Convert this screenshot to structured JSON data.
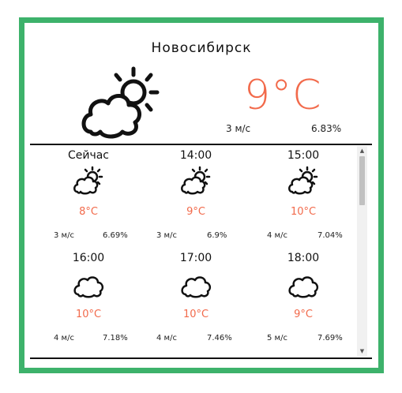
{
  "city": "Новосибирск",
  "current": {
    "icon": "partly-cloudy-icon",
    "temp": "9°C",
    "wind": "3 м/с",
    "humidity": "6.83%"
  },
  "forecast": [
    {
      "time": "Сейчас",
      "icon": "partly-cloudy-icon",
      "temp": "8°C",
      "wind": "3 м/с",
      "humidity": "6.69%"
    },
    {
      "time": "14:00",
      "icon": "partly-cloudy-icon",
      "temp": "9°C",
      "wind": "3 м/с",
      "humidity": "6.9%"
    },
    {
      "time": "15:00",
      "icon": "partly-cloudy-icon",
      "temp": "10°C",
      "wind": "4 м/с",
      "humidity": "7.04%"
    },
    {
      "time": "16:00",
      "icon": "cloud-icon",
      "temp": "10°C",
      "wind": "4 м/с",
      "humidity": "7.18%"
    },
    {
      "time": "17:00",
      "icon": "cloud-icon",
      "temp": "10°C",
      "wind": "4 м/с",
      "humidity": "7.46%"
    },
    {
      "time": "18:00",
      "icon": "cloud-icon",
      "temp": "9°C",
      "wind": "5 м/с",
      "humidity": "7.69%"
    }
  ],
  "colors": {
    "accent": "#f26a4b",
    "border": "#3db26b"
  }
}
